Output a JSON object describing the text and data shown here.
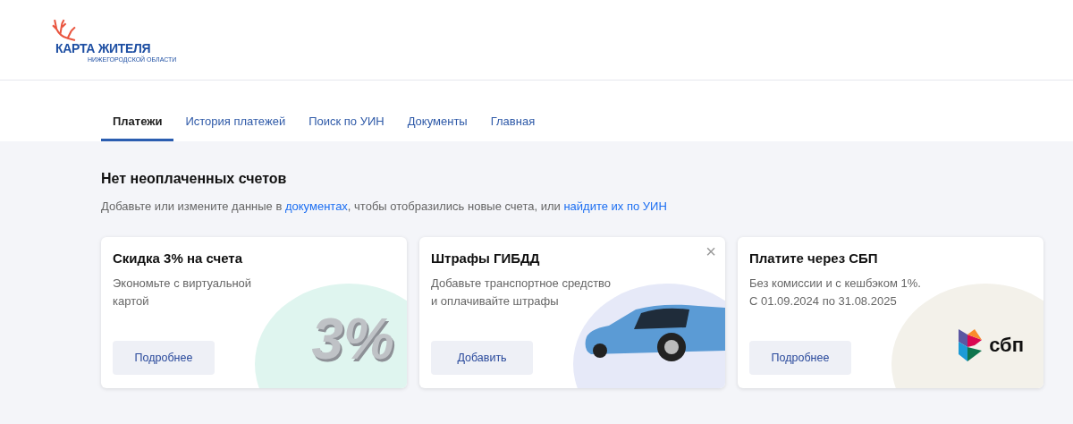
{
  "logo": {
    "title": "КАРТА ЖИТЕЛЯ",
    "subtitle": "НИЖЕГОРОДСКОЙ ОБЛАСТИ"
  },
  "tabs": [
    {
      "label": "Платежи",
      "selected": true
    },
    {
      "label": "История платежей",
      "selected": false
    },
    {
      "label": "Поиск по УИН",
      "selected": false
    },
    {
      "label": "Документы",
      "selected": false
    },
    {
      "label": "Главная",
      "selected": false
    }
  ],
  "notice": {
    "title": "Нет неоплаченных счетов",
    "text_before": "Добавьте или измените данные в",
    "link_documents": "документах",
    "text_middle": ", чтобы отобразились новые счета, или",
    "link_search": "найдите их по УИН"
  },
  "cards": [
    {
      "kind": "discount",
      "title": "Скидка 3% на счета",
      "lines": [
        "Экономьте с виртуальной",
        "картой"
      ],
      "button": "Подробнее",
      "art_text": "3%",
      "color": "#dff5ef"
    },
    {
      "kind": "car",
      "title": "Штрафы ГИБДД",
      "lines": [
        "Добавьте транспортное средство",
        "и оплачивайте штрафы"
      ],
      "button": "Добавить",
      "close": "×",
      "color": "#e6e9f8"
    },
    {
      "kind": "sbp",
      "title": "Платите через СБП",
      "lines": [
        "Без комиссии и с кешбэком 1%.",
        "С 01.09.2024 по 31.08.2025"
      ],
      "button": "Подробнее",
      "art_text": "сбп",
      "color": "#f3f1ea"
    }
  ]
}
